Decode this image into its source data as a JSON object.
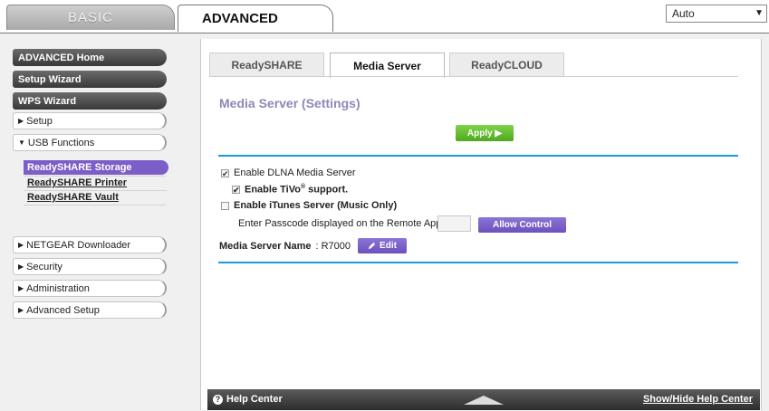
{
  "top_tabs": {
    "basic": "BASIC",
    "advanced": "ADVANCED"
  },
  "language": {
    "selected": "Auto",
    "arrow": "▼"
  },
  "sidebar": {
    "advanced_home": "ADVANCED Home",
    "setup_wizard": "Setup Wizard",
    "wps_wizard": "WPS Wizard",
    "setup": "Setup",
    "usb_functions": "USB Functions",
    "usb_sub": [
      "ReadySHARE Storage",
      "ReadySHARE Printer",
      "ReadySHARE Vault"
    ],
    "netgear_downloader": "NETGEAR Downloader",
    "security": "Security",
    "administration": "Administration",
    "advanced_setup": "Advanced Setup",
    "collapsed_arrow": "▶",
    "expanded_arrow": "▼"
  },
  "inner_tabs": [
    "ReadySHARE",
    "Media Server",
    "ReadyCLOUD"
  ],
  "main": {
    "title": "Media Server (Settings)",
    "apply_label": "Apply ▶",
    "enable_dlna": {
      "label": "Enable DLNA Media Server",
      "checked": true
    },
    "enable_tivo": {
      "label_pre": "Enable TiVo",
      "sup": "®",
      "label_post": " support.",
      "checked": true
    },
    "enable_itunes": {
      "label": "Enable iTunes Server (Music Only)",
      "checked": false
    },
    "passcode_label": "Enter Passcode displayed on the Remote App",
    "passcode_value": "",
    "allow_control": "Allow Control",
    "media_server_name_label": "Media Server Name",
    "media_server_name_value": ": R7000",
    "edit_label": "Edit"
  },
  "help": {
    "left": "Help Center",
    "right": "Show/Hide Help Center",
    "icon": "?"
  },
  "colors": {
    "accent_purple": "#7b5ec8",
    "apply_green": "#5bb52b",
    "rule_blue": "#1a9bd7",
    "title": "#8f87b8"
  }
}
